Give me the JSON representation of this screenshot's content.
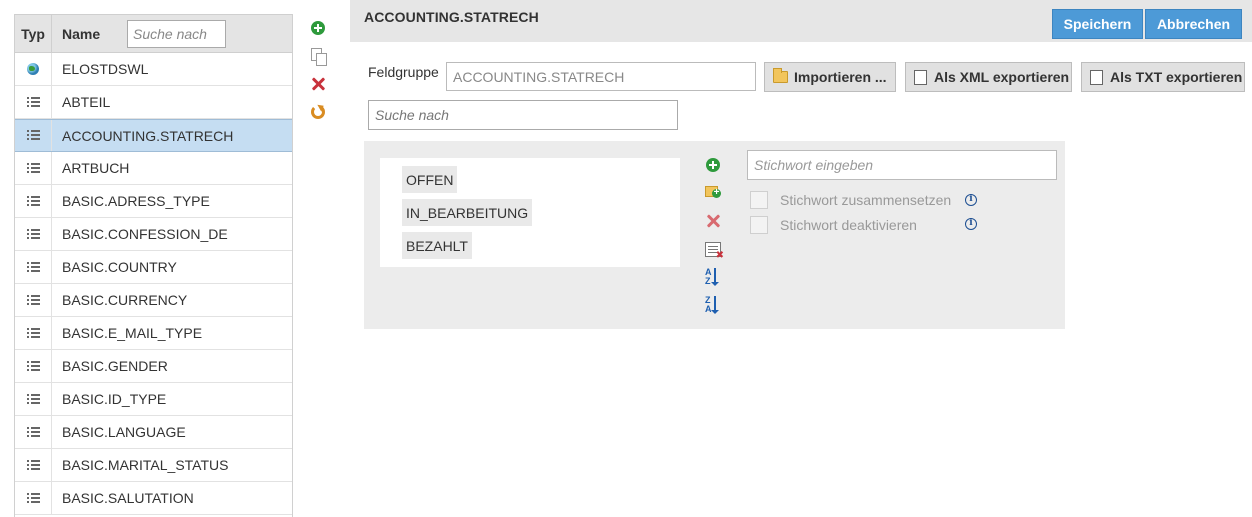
{
  "list": {
    "header_typ": "Typ",
    "header_name": "Name",
    "search_placeholder": "Suche nach",
    "rows": [
      {
        "label": "ELOSTDSWL",
        "icon": "globe-icon"
      },
      {
        "label": "ABTEIL",
        "icon": "list-icon"
      },
      {
        "label": "ACCOUNTING.STATRECH",
        "icon": "list-icon",
        "selected": true
      },
      {
        "label": "ARTBUCH",
        "icon": "list-icon"
      },
      {
        "label": "BASIC.ADRESS_TYPE",
        "icon": "list-icon"
      },
      {
        "label": "BASIC.CONFESSION_DE",
        "icon": "list-icon"
      },
      {
        "label": "BASIC.COUNTRY",
        "icon": "list-icon"
      },
      {
        "label": "BASIC.CURRENCY",
        "icon": "list-icon"
      },
      {
        "label": "BASIC.E_MAIL_TYPE",
        "icon": "list-icon"
      },
      {
        "label": "BASIC.GENDER",
        "icon": "list-icon"
      },
      {
        "label": "BASIC.ID_TYPE",
        "icon": "list-icon"
      },
      {
        "label": "BASIC.LANGUAGE",
        "icon": "list-icon"
      },
      {
        "label": "BASIC.MARITAL_STATUS",
        "icon": "list-icon"
      },
      {
        "label": "BASIC.SALUTATION",
        "icon": "list-icon"
      }
    ]
  },
  "left_actions": [
    "add-icon",
    "copy-icon",
    "delete-icon",
    "refresh-icon"
  ],
  "detail": {
    "title": "ACCOUNTING.STATRECH",
    "save_label": "Speichern",
    "cancel_label": "Abbrechen",
    "feldgruppe_label": "Feldgruppe",
    "feldgruppe_value": "ACCOUNTING.STATRECH",
    "import_label": "Importieren ...",
    "xml_export_label": "Als XML exportieren",
    "txt_export_label": "Als TXT exportieren",
    "search_placeholder": "Suche nach",
    "values": [
      "OFFEN",
      "IN_BEARBEITUNG",
      "BEZAHLT"
    ],
    "keyword_placeholder": "Stichwort eingeben",
    "checkbox_compose": "Stichwort zusammensetzen",
    "checkbox_deactivate": "Stichwort deaktivieren"
  },
  "colors": {
    "primary": "#4d9ad7",
    "selected_row": "#c5ddf2",
    "add_green": "#2e9a3c",
    "delete_red": "#c8323c"
  }
}
